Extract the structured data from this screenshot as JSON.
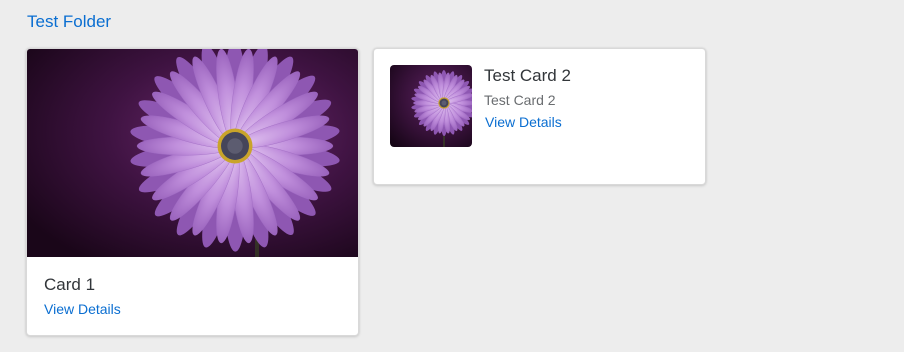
{
  "folder": {
    "title": "Test Folder"
  },
  "cards": [
    {
      "title": "Card 1",
      "link_label": "View Details",
      "image": "purple-daisy-flower"
    },
    {
      "title": "Test Card 2",
      "subtitle": "Test Card 2",
      "link_label": "View Details",
      "image": "purple-daisy-flower"
    }
  ],
  "colors": {
    "background": "#ededed",
    "link": "#0a6ed1",
    "title_text": "#32363a",
    "subtitle_text": "#6a6d70",
    "flower_petal": "#b67fd4",
    "flower_center": "#4a4a5a",
    "image_background": "#2a0c2c"
  }
}
